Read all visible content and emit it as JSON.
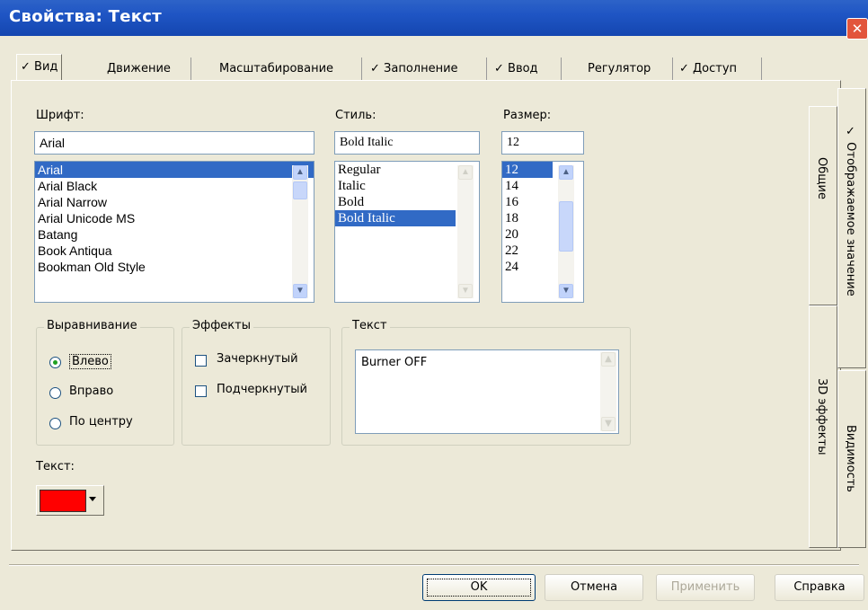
{
  "window": {
    "title": "Свойства: Текст",
    "close_glyph": "✕"
  },
  "tabs": [
    {
      "label": "✓ Вид"
    },
    {
      "label": "Движение"
    },
    {
      "label": "Масштабирование"
    },
    {
      "label": "✓ Заполнение"
    },
    {
      "label": "✓ Ввод"
    },
    {
      "label": "Регулятор"
    },
    {
      "label": "✓ Доступ"
    }
  ],
  "side_tabs": {
    "general": "Общие",
    "displayed_value": "✓ Отображаемое значение",
    "effects_3d": "3D эффекты",
    "visibility": "Видимость"
  },
  "font": {
    "label": "Шрифт:",
    "value": "Arial",
    "items": [
      "Arial",
      "Arial Black",
      "Arial Narrow",
      "Arial Unicode MS",
      "Batang",
      "Book Antiqua",
      "Bookman Old Style"
    ],
    "selected": "Arial"
  },
  "style": {
    "label": "Стиль:",
    "value": "Bold Italic",
    "items": [
      "Regular",
      "Italic",
      "Bold",
      "Bold Italic"
    ],
    "selected": "Bold Italic"
  },
  "size": {
    "label": "Размер:",
    "value": "12",
    "items": [
      "12",
      "14",
      "16",
      "18",
      "20",
      "22",
      "24"
    ],
    "selected": "12"
  },
  "alignment": {
    "title": "Выравнивание",
    "options": [
      "Влево",
      "Вправо",
      "По центру"
    ],
    "selected": "Влево"
  },
  "effects": {
    "title": "Эффекты",
    "strikeout": "Зачеркнутый",
    "underline": "Подчеркнутый"
  },
  "text_group": {
    "title": "Текст",
    "value": "Burner OFF"
  },
  "text_color": {
    "label": "Текст:",
    "color": "#ff0000"
  },
  "buttons": {
    "ok": "OK",
    "cancel": "Отмена",
    "apply": "Применить",
    "help": "Справка"
  },
  "colors": {
    "titlebar": "#1f55c4",
    "selection": "#316ac5",
    "dialog_bg": "#ece9d8"
  }
}
